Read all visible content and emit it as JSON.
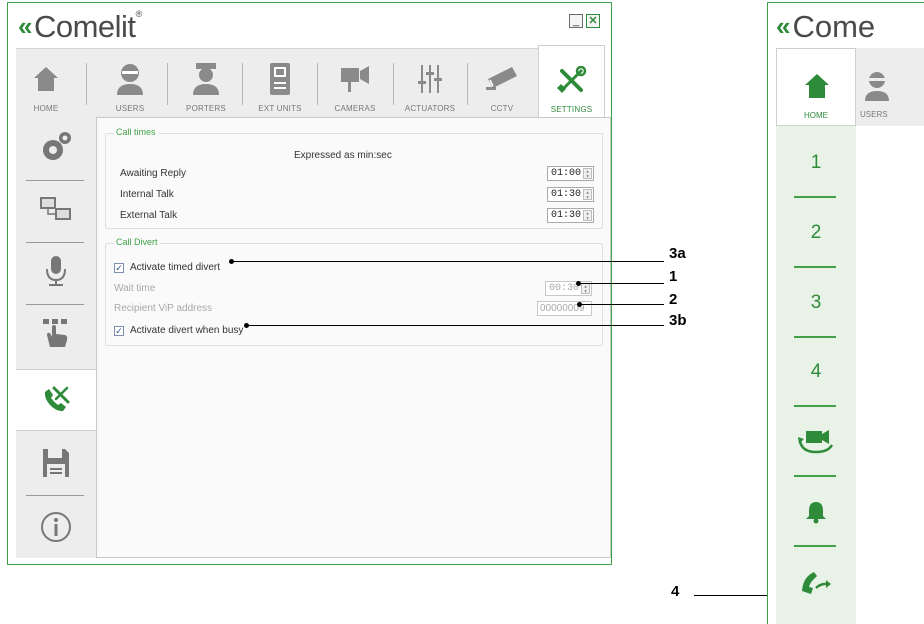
{
  "app": {
    "brand": "Comelit",
    "trademark": "®",
    "brand_color": "#2e8b3a"
  },
  "window": {
    "minimize": "_",
    "close": "✕"
  },
  "tabs": [
    {
      "label": "HOME",
      "icon": "home-icon"
    },
    {
      "label": "USERS",
      "icon": "user-icon"
    },
    {
      "label": "PORTERS",
      "icon": "porter-icon"
    },
    {
      "label": "EXT UNITS",
      "icon": "external-unit-icon"
    },
    {
      "label": "CAMERAS",
      "icon": "camera-icon"
    },
    {
      "label": "ACTUATORS",
      "icon": "actuator-icon"
    },
    {
      "label": "CCTV",
      "icon": "cctv-icon"
    },
    {
      "label": "SETTINGS",
      "icon": "settings-icon",
      "active": true
    }
  ],
  "sidebar": [
    {
      "icon": "gears-icon"
    },
    {
      "icon": "network-icon"
    },
    {
      "icon": "microphone-icon"
    },
    {
      "icon": "touch-icon"
    },
    {
      "icon": "call-divert-icon",
      "active": true
    },
    {
      "icon": "save-icon"
    },
    {
      "icon": "info-icon"
    }
  ],
  "call_times": {
    "title": "Call times",
    "note": "Expressed as min:sec",
    "rows": [
      {
        "label": "Awaiting Reply",
        "value": "01:00"
      },
      {
        "label": "Internal Talk",
        "value": "01:30"
      },
      {
        "label": "External Talk",
        "value": "01:30"
      }
    ]
  },
  "call_divert": {
    "title": "Call Divert",
    "timed_divert": {
      "label": "Activate timed divert",
      "checked": true
    },
    "wait_time": {
      "label": "Wait time",
      "value": "00:30"
    },
    "recipient": {
      "label": "Recipient ViP address",
      "value": "00000009"
    },
    "busy_divert": {
      "label": "Activate divert when busy",
      "checked": true
    }
  },
  "callouts": [
    "3a",
    "1",
    "2",
    "3b",
    "4"
  ],
  "window2": {
    "brand": "Come",
    "tabs": [
      "HOME",
      "USERS"
    ],
    "side": [
      "1",
      "2",
      "3",
      "4"
    ],
    "side_icons": [
      "camera-switch-icon",
      "bell-icon",
      "call-forward-icon"
    ]
  }
}
